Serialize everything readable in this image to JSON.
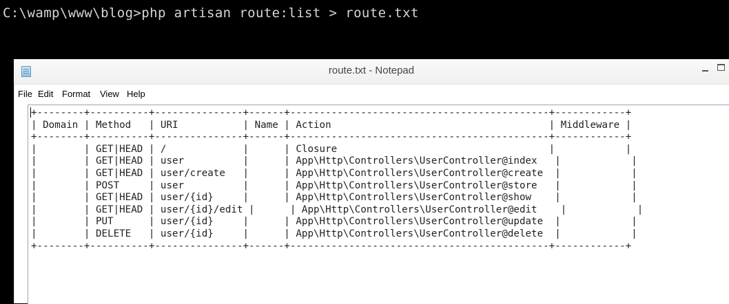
{
  "console": {
    "command_line": "C:\\wamp\\www\\blog>php artisan route:list > route.txt"
  },
  "notepad": {
    "title": "route.txt - Notepad",
    "menu": [
      "File",
      "Edit",
      "Format",
      "View",
      "Help"
    ],
    "content": "+--------+----------+---------------+------+--------------------------------------------+------------+\n| Domain | Method   | URI           | Name | Action                                     | Middleware |\n+--------+----------+---------------+------+--------------------------------------------+------------+\n|        | GET|HEAD | /             |      | Closure                                    |            |\n|        | GET|HEAD | user          |      | App\\Http\\Controllers\\UserController@index   |            |\n|        | GET|HEAD | user/create   |      | App\\Http\\Controllers\\UserController@create  |            |\n|        | POST     | user          |      | App\\Http\\Controllers\\UserController@store   |            |\n|        | GET|HEAD | user/{id}     |      | App\\Http\\Controllers\\UserController@show    |            |\n|        | GET|HEAD | user/{id}/edit |      | App\\Http\\Controllers\\UserController@edit    |            |\n|        | PUT      | user/{id}     |      | App\\Http\\Controllers\\UserController@update  |            |\n|        | DELETE   | user/{id}     |      | App\\Http\\Controllers\\UserController@delete  |            |\n+--------+----------+---------------+------+--------------------------------------------+------------+"
  }
}
